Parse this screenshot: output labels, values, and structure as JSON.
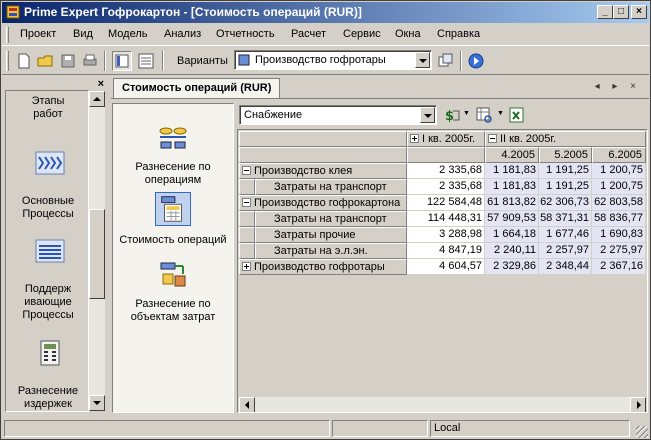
{
  "window": {
    "title": "Prime Expert  Гофрокартон - [Стоимость операций (RUR)]",
    "buttons": {
      "minimize": "_",
      "maximize": "□",
      "close": "×"
    }
  },
  "menu": {
    "items": [
      "Проект",
      "Вид",
      "Модель",
      "Анализ",
      "Отчетность",
      "Расчет",
      "Сервис",
      "Окна",
      "Справка"
    ]
  },
  "toolbar": {
    "variants_label": "Варианты",
    "variant_selected": "Производство гофротары"
  },
  "nav": {
    "items": [
      {
        "label": "Этапы работ",
        "icon": "stages-icon"
      },
      {
        "label": "Основные Процессы",
        "icon": "main-processes-icon"
      },
      {
        "label": "Поддерживающие Процессы",
        "icon": "support-processes-icon"
      },
      {
        "label": "Разнесение издержек",
        "icon": "cost-allocation-icon"
      }
    ],
    "item_lines": [
      [
        "Этапы",
        "работ"
      ],
      [
        "Основные",
        "Процессы"
      ],
      [
        "Поддерж",
        "ивающие",
        "Процессы"
      ],
      [
        "Разнесение",
        "издержек"
      ]
    ]
  },
  "document": {
    "tab_title": "Стоимость операций (RUR)",
    "nav_arrows": "◂ ▸ ×"
  },
  "operations": {
    "items": [
      {
        "lines": [
          "Разнесение по",
          "операциям"
        ],
        "icon": "distribute-by-operations-icon"
      },
      {
        "lines": [
          "Стоимость операций"
        ],
        "icon": "operations-cost-icon",
        "selected": true
      },
      {
        "lines": [
          "Разнесение по",
          "объектам затрат"
        ],
        "icon": "distribute-by-cost-objects-icon"
      }
    ]
  },
  "grid": {
    "filter_selected": "Снабжение",
    "col_groups": [
      {
        "label": "I кв. 2005г.",
        "expander": "plus"
      },
      {
        "label": "II кв. 2005г.",
        "expander": "minus"
      }
    ],
    "sub_columns": [
      "4.2005",
      "5.2005",
      "6.2005"
    ],
    "rows": [
      {
        "label": "Производство клея",
        "level": 0,
        "expander": "minus",
        "values": [
          "2 335,68",
          "1 181,83",
          "1 191,25",
          "1 200,75"
        ]
      },
      {
        "label": "Затраты на транспорт",
        "level": 1,
        "expander": "",
        "values": [
          "2 335,68",
          "1 181,83",
          "1 191,25",
          "1 200,75"
        ]
      },
      {
        "label": "Производство гофрокартона",
        "level": 0,
        "expander": "minus",
        "values": [
          "122 584,48",
          "61 813,82",
          "62 306,73",
          "62 803,58"
        ]
      },
      {
        "label": "Затраты на транспорт",
        "level": 1,
        "expander": "",
        "values": [
          "114 448,31",
          "57 909,53",
          "58 371,31",
          "58 836,77"
        ]
      },
      {
        "label": "Затраты прочие",
        "level": 1,
        "expander": "",
        "values": [
          "3 288,98",
          "1 664,18",
          "1 677,46",
          "1 690,83"
        ]
      },
      {
        "label": "Затраты на э.л.эн.",
        "level": 1,
        "expander": "",
        "values": [
          "4 847,19",
          "2 240,11",
          "2 257,97",
          "2 275,97"
        ]
      },
      {
        "label": "Производство гофротары",
        "level": 0,
        "expander": "plus",
        "values": [
          "4 604,57",
          "2 329,86",
          "2 348,44",
          "2 367,16"
        ]
      }
    ]
  },
  "status": {
    "mode": "Local"
  },
  "colors": {
    "title_start": "#0a246a",
    "title_end": "#a6caf0",
    "cell_highlight": "#e4e4f4",
    "selection": "#316ac5"
  }
}
